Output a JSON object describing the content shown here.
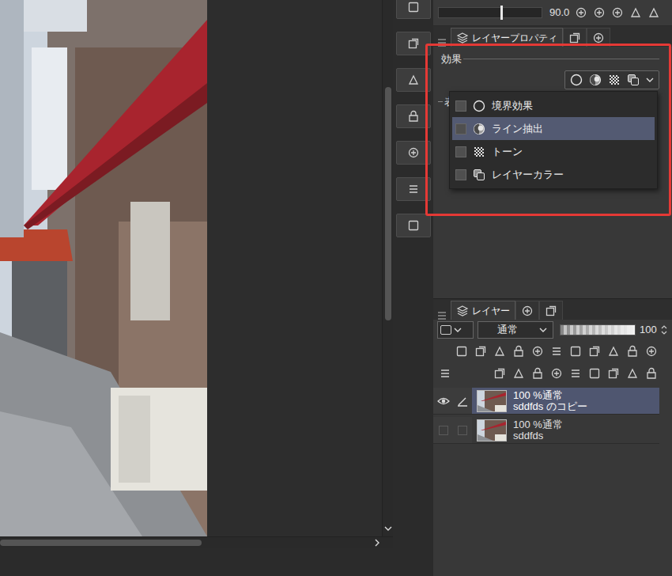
{
  "rotation": {
    "level": 0.6,
    "angle": "90.0"
  },
  "property_panel": {
    "tabs": [
      {
        "label": "レイヤープロパティ",
        "selected": true
      }
    ]
  },
  "effects": {
    "title": "効果",
    "next_section": "表",
    "menu": [
      {
        "label": "境界効果",
        "checked": false,
        "selected": false
      },
      {
        "label": "ライン抽出",
        "checked": false,
        "selected": true
      },
      {
        "label": "トーン",
        "checked": false,
        "selected": false
      },
      {
        "label": "レイヤーカラー",
        "checked": false,
        "selected": false
      }
    ]
  },
  "layer_panel": {
    "tabs": [
      {
        "label": "レイヤー",
        "selected": true
      }
    ],
    "blend_mode": "通常",
    "opacity": {
      "level": 1,
      "reading": "100"
    },
    "layers": [
      {
        "status": "100 %通常",
        "name": "sddfds のコピー",
        "visible": true,
        "editing": true,
        "selected": true
      },
      {
        "status": "100 %通常",
        "name": "sddfds",
        "visible": false,
        "editing": false,
        "selected": false
      }
    ]
  }
}
